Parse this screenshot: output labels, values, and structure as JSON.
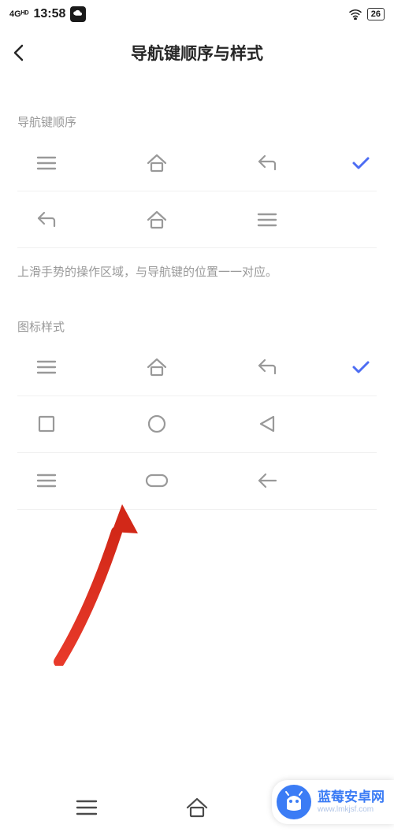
{
  "status": {
    "signal": "4Gᴴᴰ",
    "time": "13:58",
    "battery": "26"
  },
  "header": {
    "title": "导航键顺序与样式"
  },
  "sections": {
    "order_label": "导航键顺序",
    "gesture_note": "上滑手势的操作区域，与导航键的位置一一对应。",
    "style_label": "图标样式"
  },
  "nav_order_options": [
    {
      "icons": [
        "menu",
        "home",
        "back"
      ],
      "selected": true
    },
    {
      "icons": [
        "back",
        "home",
        "menu"
      ],
      "selected": false
    }
  ],
  "icon_style_options": [
    {
      "icons": [
        "menu",
        "home",
        "back"
      ],
      "selected": true
    },
    {
      "icons": [
        "square",
        "circle",
        "triangle-left"
      ],
      "selected": false
    },
    {
      "icons": [
        "menu",
        "pill",
        "arrow-left"
      ],
      "selected": false
    }
  ],
  "watermark": {
    "main": "蓝莓安卓网",
    "sub": "www.lmkjsf.com"
  }
}
